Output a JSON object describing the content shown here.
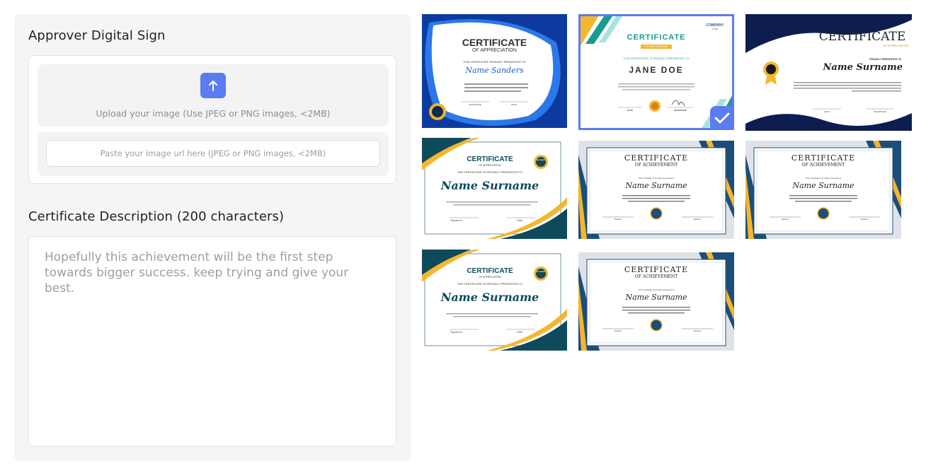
{
  "signature": {
    "title": "Approver Digital Sign",
    "upload_text": "Upload your image (Use JPEG or PNG images, <2MB)",
    "url_placeholder": "Paste your image url here (JPEG or PNG images, <2MB)"
  },
  "description": {
    "title": "Certificate Description (200 characters)",
    "value": "Hopefully this achievement will be the first step towards bigger success. keep trying and give your best."
  },
  "templates": [
    {
      "heading": "CERTIFICATE",
      "sub": "OF APPRECIATION",
      "presented": "THIS CERTIFICATE PROUDLY PRESENTED TO",
      "name": "Name Sanders",
      "sign": "SIGNATURE",
      "date": "DATE"
    },
    {
      "heading": "CERTIFICATE",
      "sub": "OF PARTICIPATION",
      "company": "COMPANY",
      "company_sub": "NAME",
      "presented": "THIS CERTIFICATE IS PROUDLY PRESENTED TO",
      "name": "JANE DOE",
      "date": "DATE",
      "sign": "SIGNATURE",
      "selected": true
    },
    {
      "heading": "CERTIFICATE",
      "sub": "OF APPRECIATION",
      "presented": "PROUDLY PRESENTED TO",
      "name": "Name Surname",
      "date": "DATE",
      "sign": "SIGNATURE"
    },
    {
      "heading": "CERTIFICATE",
      "sub": "OF APPRECIATION",
      "presented": "THE CERTIFICATE IS PROUDLY PRESENTED TO",
      "name": "Name Surname",
      "badge": "BEST AWARD",
      "sign": "Signature",
      "date": "Date"
    },
    {
      "heading": "CERTIFICATE",
      "sub": "OF ACHIEVEMENT",
      "presented": "This certificate is proudly presented to",
      "name": "Name Surname",
      "sign": "Signature",
      "sign2": "Signature"
    },
    {
      "heading": "CERTIFICATE",
      "sub": "OF ACHIEVEMENT",
      "presented": "This certificate is proudly presented to",
      "name": "Name Surname",
      "sign": "Signature",
      "sign2": "Signature"
    },
    {
      "heading": "CERTIFICATE",
      "sub": "OF APPRECIATION",
      "presented": "THE CERTIFICATE IS PROUDLY PRESENTED TO",
      "name": "Name Surname",
      "badge": "BEST AWARD",
      "sign": "Signature",
      "date": "Date"
    },
    {
      "heading": "CERTIFICATE",
      "sub": "OF ACHIEVEMENT",
      "presented": "This certificate is proudly presented to",
      "name": "Name Surname",
      "sign": "Signature",
      "sign2": "Signature"
    }
  ],
  "icons": {
    "upload": "arrow-up-icon",
    "selected": "checkmark-icon"
  },
  "colors": {
    "accent": "#5b7cf0",
    "navy": "#0f3a63",
    "gold": "#f4b62c",
    "royal_blue": "#1a5bd6"
  }
}
